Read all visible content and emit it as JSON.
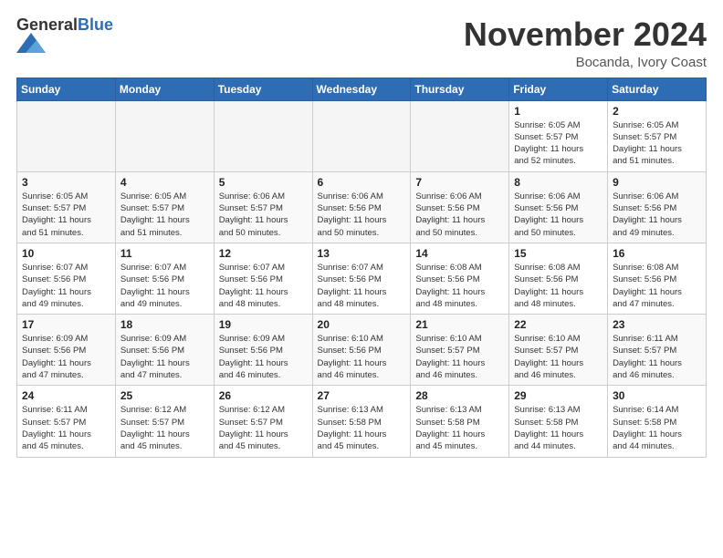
{
  "header": {
    "logo_general": "General",
    "logo_blue": "Blue",
    "month_title": "November 2024",
    "location": "Bocanda, Ivory Coast"
  },
  "weekdays": [
    "Sunday",
    "Monday",
    "Tuesday",
    "Wednesday",
    "Thursday",
    "Friday",
    "Saturday"
  ],
  "weeks": [
    [
      {
        "day": "",
        "info": ""
      },
      {
        "day": "",
        "info": ""
      },
      {
        "day": "",
        "info": ""
      },
      {
        "day": "",
        "info": ""
      },
      {
        "day": "",
        "info": ""
      },
      {
        "day": "1",
        "info": "Sunrise: 6:05 AM\nSunset: 5:57 PM\nDaylight: 11 hours\nand 52 minutes."
      },
      {
        "day": "2",
        "info": "Sunrise: 6:05 AM\nSunset: 5:57 PM\nDaylight: 11 hours\nand 51 minutes."
      }
    ],
    [
      {
        "day": "3",
        "info": "Sunrise: 6:05 AM\nSunset: 5:57 PM\nDaylight: 11 hours\nand 51 minutes."
      },
      {
        "day": "4",
        "info": "Sunrise: 6:05 AM\nSunset: 5:57 PM\nDaylight: 11 hours\nand 51 minutes."
      },
      {
        "day": "5",
        "info": "Sunrise: 6:06 AM\nSunset: 5:57 PM\nDaylight: 11 hours\nand 50 minutes."
      },
      {
        "day": "6",
        "info": "Sunrise: 6:06 AM\nSunset: 5:56 PM\nDaylight: 11 hours\nand 50 minutes."
      },
      {
        "day": "7",
        "info": "Sunrise: 6:06 AM\nSunset: 5:56 PM\nDaylight: 11 hours\nand 50 minutes."
      },
      {
        "day": "8",
        "info": "Sunrise: 6:06 AM\nSunset: 5:56 PM\nDaylight: 11 hours\nand 50 minutes."
      },
      {
        "day": "9",
        "info": "Sunrise: 6:06 AM\nSunset: 5:56 PM\nDaylight: 11 hours\nand 49 minutes."
      }
    ],
    [
      {
        "day": "10",
        "info": "Sunrise: 6:07 AM\nSunset: 5:56 PM\nDaylight: 11 hours\nand 49 minutes."
      },
      {
        "day": "11",
        "info": "Sunrise: 6:07 AM\nSunset: 5:56 PM\nDaylight: 11 hours\nand 49 minutes."
      },
      {
        "day": "12",
        "info": "Sunrise: 6:07 AM\nSunset: 5:56 PM\nDaylight: 11 hours\nand 48 minutes."
      },
      {
        "day": "13",
        "info": "Sunrise: 6:07 AM\nSunset: 5:56 PM\nDaylight: 11 hours\nand 48 minutes."
      },
      {
        "day": "14",
        "info": "Sunrise: 6:08 AM\nSunset: 5:56 PM\nDaylight: 11 hours\nand 48 minutes."
      },
      {
        "day": "15",
        "info": "Sunrise: 6:08 AM\nSunset: 5:56 PM\nDaylight: 11 hours\nand 48 minutes."
      },
      {
        "day": "16",
        "info": "Sunrise: 6:08 AM\nSunset: 5:56 PM\nDaylight: 11 hours\nand 47 minutes."
      }
    ],
    [
      {
        "day": "17",
        "info": "Sunrise: 6:09 AM\nSunset: 5:56 PM\nDaylight: 11 hours\nand 47 minutes."
      },
      {
        "day": "18",
        "info": "Sunrise: 6:09 AM\nSunset: 5:56 PM\nDaylight: 11 hours\nand 47 minutes."
      },
      {
        "day": "19",
        "info": "Sunrise: 6:09 AM\nSunset: 5:56 PM\nDaylight: 11 hours\nand 46 minutes."
      },
      {
        "day": "20",
        "info": "Sunrise: 6:10 AM\nSunset: 5:56 PM\nDaylight: 11 hours\nand 46 minutes."
      },
      {
        "day": "21",
        "info": "Sunrise: 6:10 AM\nSunset: 5:57 PM\nDaylight: 11 hours\nand 46 minutes."
      },
      {
        "day": "22",
        "info": "Sunrise: 6:10 AM\nSunset: 5:57 PM\nDaylight: 11 hours\nand 46 minutes."
      },
      {
        "day": "23",
        "info": "Sunrise: 6:11 AM\nSunset: 5:57 PM\nDaylight: 11 hours\nand 46 minutes."
      }
    ],
    [
      {
        "day": "24",
        "info": "Sunrise: 6:11 AM\nSunset: 5:57 PM\nDaylight: 11 hours\nand 45 minutes."
      },
      {
        "day": "25",
        "info": "Sunrise: 6:12 AM\nSunset: 5:57 PM\nDaylight: 11 hours\nand 45 minutes."
      },
      {
        "day": "26",
        "info": "Sunrise: 6:12 AM\nSunset: 5:57 PM\nDaylight: 11 hours\nand 45 minutes."
      },
      {
        "day": "27",
        "info": "Sunrise: 6:13 AM\nSunset: 5:58 PM\nDaylight: 11 hours\nand 45 minutes."
      },
      {
        "day": "28",
        "info": "Sunrise: 6:13 AM\nSunset: 5:58 PM\nDaylight: 11 hours\nand 45 minutes."
      },
      {
        "day": "29",
        "info": "Sunrise: 6:13 AM\nSunset: 5:58 PM\nDaylight: 11 hours\nand 44 minutes."
      },
      {
        "day": "30",
        "info": "Sunrise: 6:14 AM\nSunset: 5:58 PM\nDaylight: 11 hours\nand 44 minutes."
      }
    ]
  ]
}
